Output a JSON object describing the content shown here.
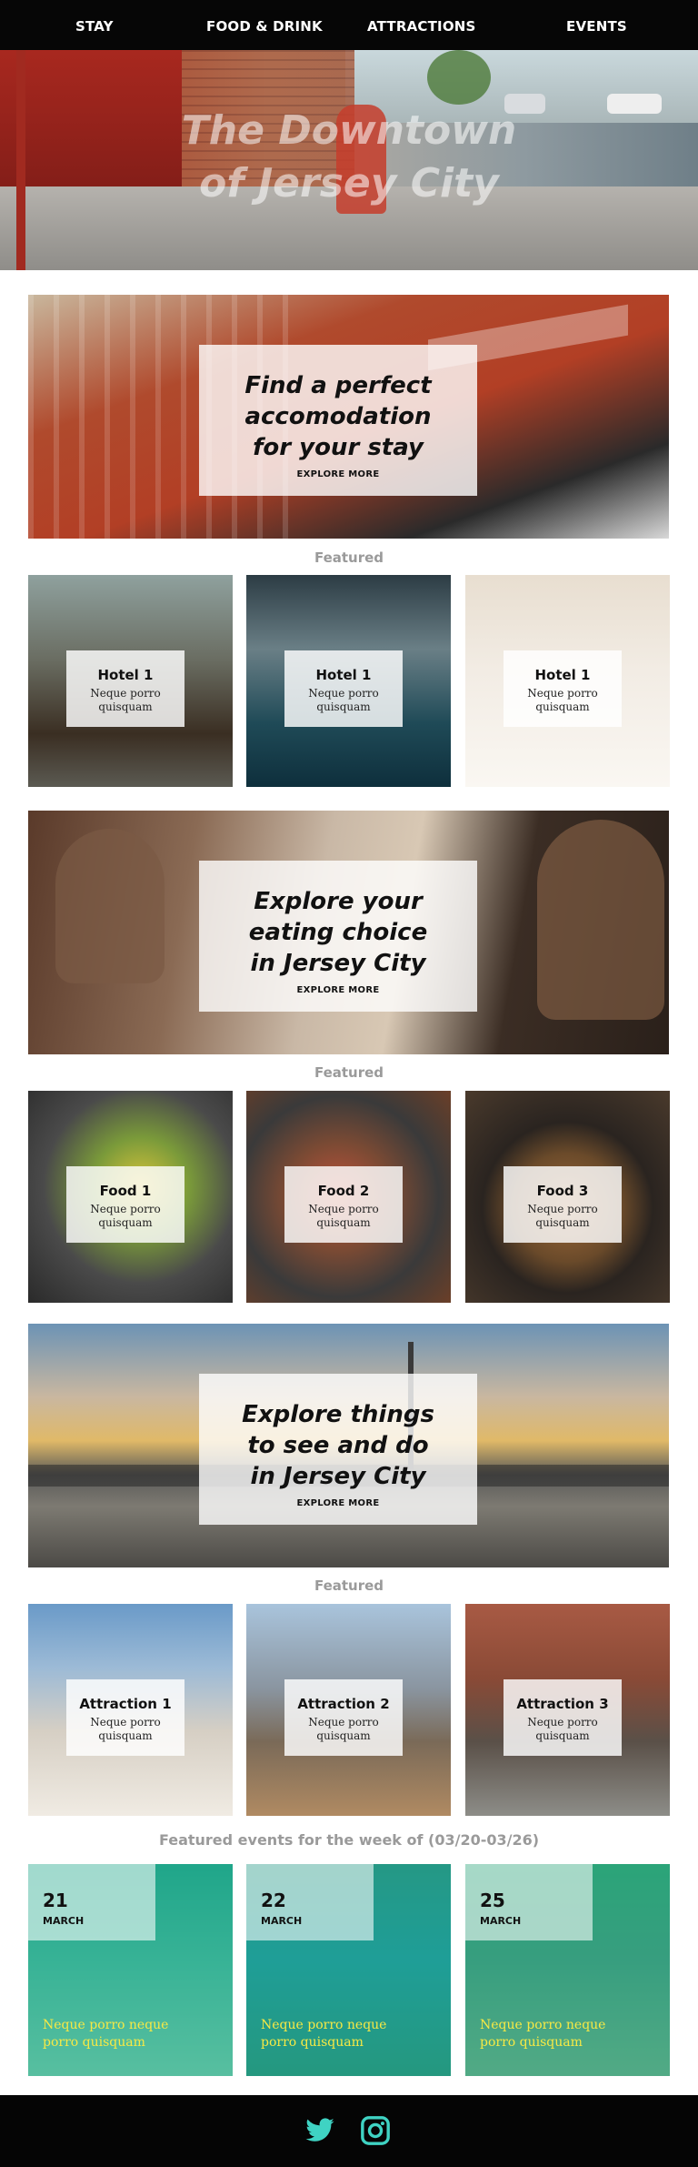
{
  "nav": {
    "items": [
      "STAY",
      "FOOD & DRINK",
      "ATTRACTIONS",
      "EVENTS"
    ]
  },
  "hero": {
    "title_line1": "The Downtown",
    "title_line2": "of Jersey City"
  },
  "stay": {
    "heading_lines": [
      "Find a perfect",
      "accomodation",
      "for your stay"
    ],
    "cta": "EXPLORE MORE",
    "featured_label": "Featured",
    "cards": [
      {
        "title": "Hotel 1",
        "desc": "Neque porro quisquam"
      },
      {
        "title": "Hotel 1",
        "desc": "Neque porro quisquam"
      },
      {
        "title": "Hotel 1",
        "desc": "Neque porro quisquam"
      }
    ]
  },
  "food": {
    "heading_lines": [
      "Explore your",
      "eating choice",
      "in Jersey City"
    ],
    "cta": "EXPLORE MORE",
    "featured_label": "Featured",
    "cards": [
      {
        "title": "Food 1",
        "desc": "Neque porro quisquam"
      },
      {
        "title": "Food 2",
        "desc": "Neque porro quisquam"
      },
      {
        "title": "Food 3",
        "desc": "Neque porro quisquam"
      }
    ]
  },
  "attractions": {
    "heading_lines": [
      "Explore things",
      "to see and do",
      "in Jersey City"
    ],
    "cta": "EXPLORE MORE",
    "featured_label": "Featured",
    "cards": [
      {
        "title": "Attraction 1",
        "desc": "Neque porro quisquam"
      },
      {
        "title": "Attraction 2",
        "desc": "Neque porro quisquam"
      },
      {
        "title": "Attraction 3",
        "desc": "Neque porro quisquam"
      }
    ]
  },
  "events": {
    "heading": "Featured events for the week of (03/20-03/26)",
    "items": [
      {
        "day": "21",
        "month": "MARCH",
        "desc": "Neque porro neque porro quisquam"
      },
      {
        "day": "22",
        "month": "MARCH",
        "desc": "Neque porro neque porro quisquam"
      },
      {
        "day": "25",
        "month": "MARCH",
        "desc": "Neque porro neque porro quisquam"
      }
    ]
  },
  "footer": {
    "icons": [
      "twitter-icon",
      "instagram-icon"
    ]
  },
  "colors": {
    "nav_bg": "#060606",
    "social_icons": "#3fd3c3",
    "event_text": "#f6e945"
  }
}
